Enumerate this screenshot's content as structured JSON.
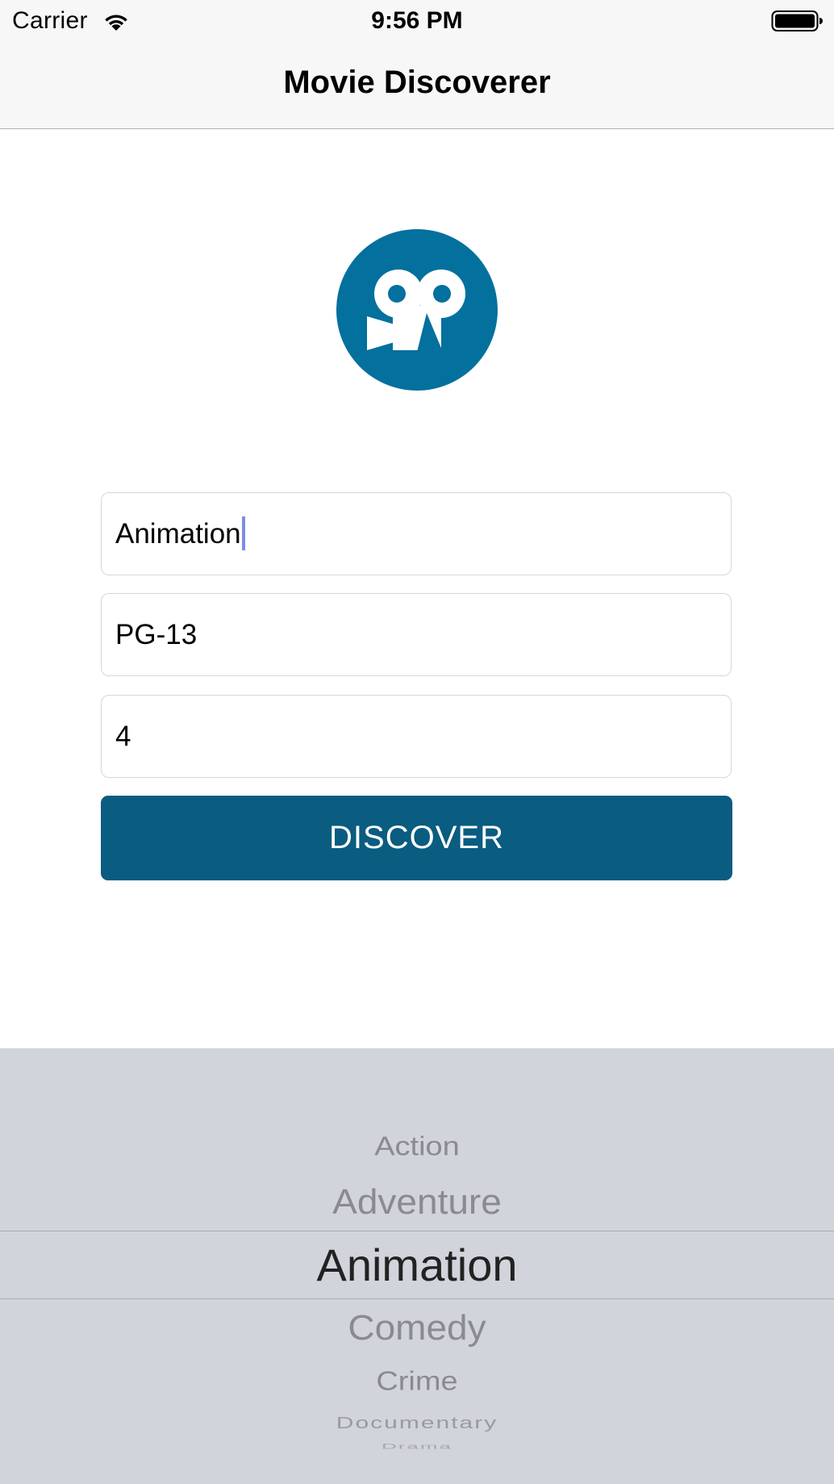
{
  "status_bar": {
    "carrier": "Carrier",
    "time": "9:56 PM",
    "wifi_icon": "wifi-icon",
    "battery_icon": "battery-icon"
  },
  "nav": {
    "title": "Movie Discoverer"
  },
  "logo": {
    "icon": "movie-camera-icon",
    "color": "#03709e"
  },
  "form": {
    "genre_value": "Animation",
    "rating_value": "PG-13",
    "count_value": "4",
    "discover_label": "DISCOVER",
    "button_color": "#0a5c80"
  },
  "picker": {
    "items": [
      "Action",
      "Adventure",
      "Animation",
      "Comedy",
      "Crime",
      "Documentary",
      "Drama"
    ],
    "selected": "Animation"
  }
}
